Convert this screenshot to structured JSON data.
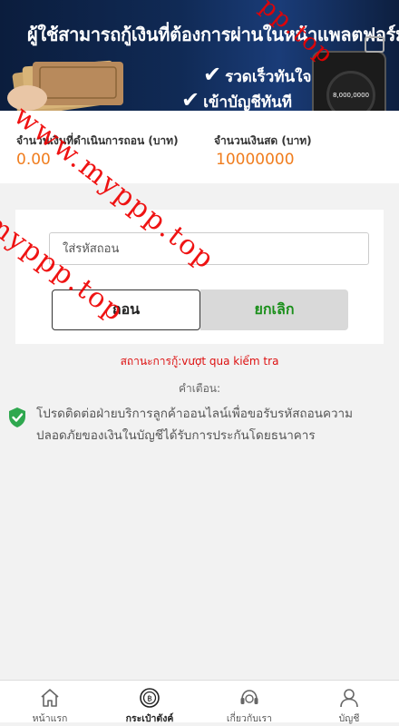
{
  "banner": {
    "headline": "ผู้ใช้สามารถกู้เงินที่ต้องการผ่านในหน้าแพลตฟอร์ม",
    "check_1": "รวดเร็วทันใจ",
    "check_2": "เข้าบัญชีทันที",
    "phone_amount": "8,000,0000"
  },
  "amounts": {
    "processing_label": "จำนวนเงินที่ดำเนินการถอน (บาท)",
    "processing_value": "0.00",
    "cash_label": "จำนวนเงินสด (บาท)",
    "cash_value": "10000000"
  },
  "form": {
    "code_placeholder": "ใส่รหัสถอน",
    "withdraw_label": "ถอน",
    "cancel_label": "ยกเลิก"
  },
  "status": {
    "text": "สถานะการกู้:vượt qua kiểm tra"
  },
  "warning": {
    "title": "คำเตือน:",
    "message": "โปรดติดต่อฝ่ายบริการลูกค้าออนไลน์เพื่อขอรับรหัสถอนความปลอดภัยของเงินในบัญชีได้รับการประกันโดยธนาคาร"
  },
  "nav": {
    "items": [
      {
        "label": "หน้าแรก",
        "icon": "home-icon"
      },
      {
        "label": "กระเป๋าตังค์",
        "icon": "wallet-icon"
      },
      {
        "label": "เกี่ยวกับเรา",
        "icon": "about-icon"
      },
      {
        "label": "บัญชี",
        "icon": "account-icon"
      }
    ],
    "active_index": 1
  },
  "watermark": {
    "text_1": "www.myppp.top",
    "text_2": "myppp.top",
    "text_3": "pp.top"
  },
  "colors": {
    "accent_orange": "#f07d1e",
    "status_red": "#dd1111",
    "cancel_green": "#1a8f1a",
    "shield_green": "#2fa84f"
  }
}
